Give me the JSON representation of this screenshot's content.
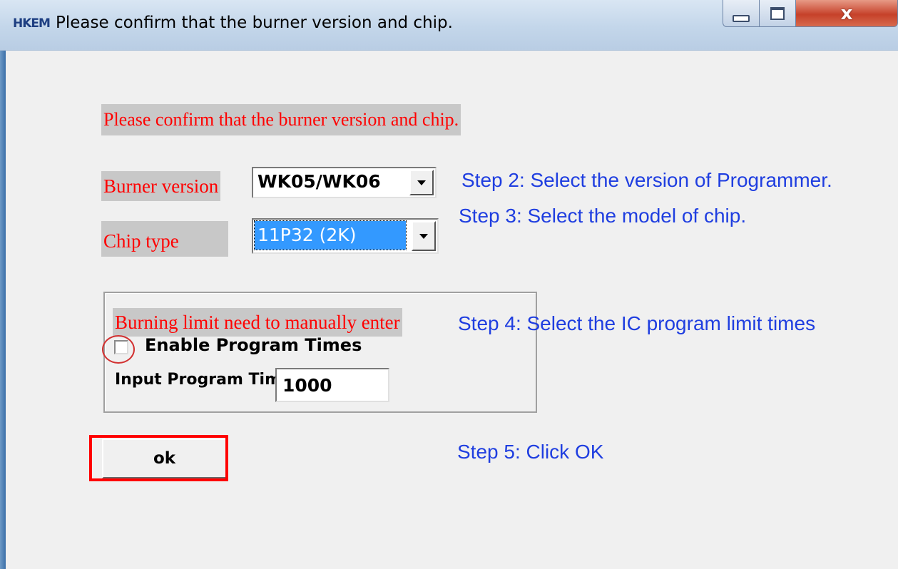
{
  "window": {
    "title": "Please confirm that the burner version and chip.",
    "icon_text": "HKEM",
    "close_glyph": "x"
  },
  "form": {
    "caption": "Please confirm that the burner version and chip.",
    "burner_label": "Burner version",
    "burner_value": "WK05/WK06",
    "chip_label": "Chip type",
    "chip_value": "11P32  (2K)",
    "limit_label": "Burning limit need to manually enter",
    "enable_label": "Enable Program Times",
    "enable_checked": false,
    "input_label": "Input Program Times",
    "input_value": "1000",
    "ok_label": "ok"
  },
  "annotations": {
    "step2": "Step 2: Select the version of Programmer.",
    "step3": "Step 3: Select the model of chip.",
    "step4": "Step 4: Select the IC program limit times",
    "step5": "Step 5: Click OK"
  },
  "colors": {
    "label_red": "#ff0000",
    "step_blue": "#1f3ee0",
    "highlight_red": "#ff0000",
    "selection_blue": "#3399ff"
  }
}
